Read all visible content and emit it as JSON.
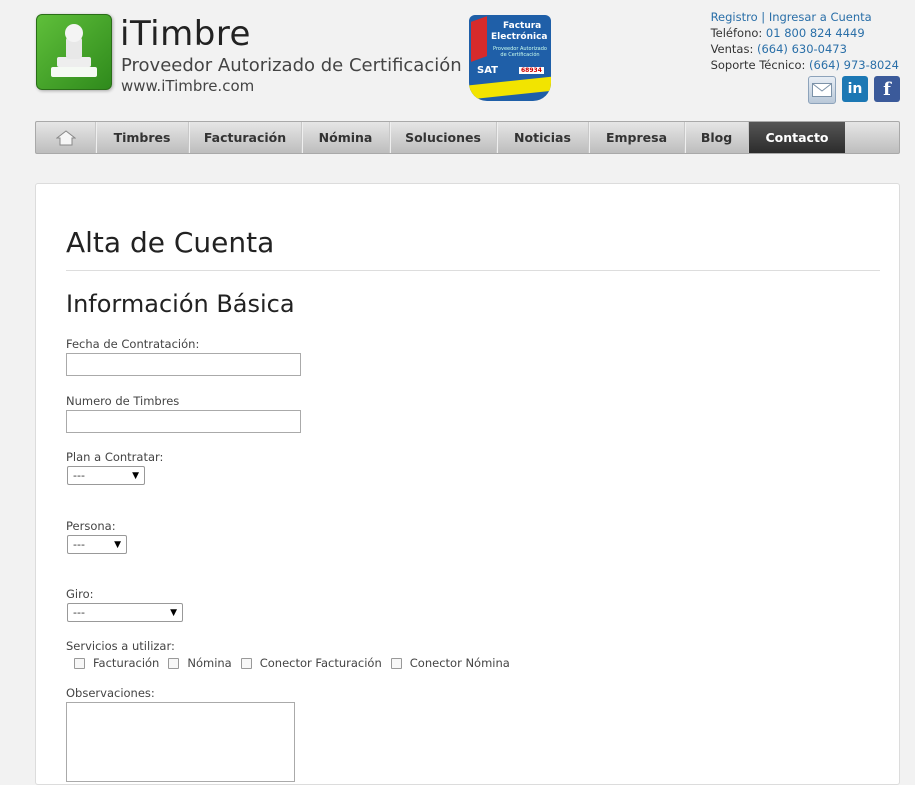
{
  "header": {
    "brand_name": "iTimbre",
    "tagline": "Proveedor Autorizado de Certificación",
    "url": "www.iTimbre.com",
    "badge": {
      "line1": "Factura",
      "line2": "Electrónica",
      "line3": "Proveedor Autorizado de Certificación",
      "sat": "SAT",
      "number": "68934"
    },
    "links": {
      "registro": "Registro",
      "separator": "|",
      "ingresar": "Ingresar a Cuenta"
    },
    "telefono_label": "Teléfono:",
    "telefono": "01 800 824 4449",
    "ventas_label": "Ventas:",
    "ventas": "(664) 630-0473",
    "soporte_label": "Soporte Técnico:",
    "soporte": "(664) 973-8024",
    "social": [
      "mail-icon",
      "linkedin-icon",
      "facebook-icon"
    ]
  },
  "nav": {
    "home_icon": "home-icon",
    "items": [
      "Timbres",
      "Facturación",
      "Nómina",
      "Soluciones",
      "Noticias",
      "Empresa",
      "Blog",
      "Contacto"
    ],
    "active": "Contacto"
  },
  "form": {
    "page_title": "Alta de Cuenta",
    "section_title": "Información Básica",
    "fecha_label": "Fecha de Contratación:",
    "fecha_value": "",
    "timbres_label": "Numero de Timbres",
    "timbres_value": "",
    "plan_label": "Plan a Contratar:",
    "plan_value": "---",
    "persona_label": "Persona:",
    "persona_value": "---",
    "giro_label": "Giro:",
    "giro_value": "---",
    "servicios_label": "Servicios a utilizar:",
    "servicios": [
      "Facturación",
      "Nómina",
      "Conector Facturación",
      "Conector Nómina"
    ],
    "observaciones_label": "Observaciones:",
    "observaciones_value": ""
  },
  "colors": {
    "link": "#2a6fa8",
    "nav_active": "#333333",
    "brand_green": "#3a9a24",
    "badge_blue": "#1f5fa8"
  }
}
